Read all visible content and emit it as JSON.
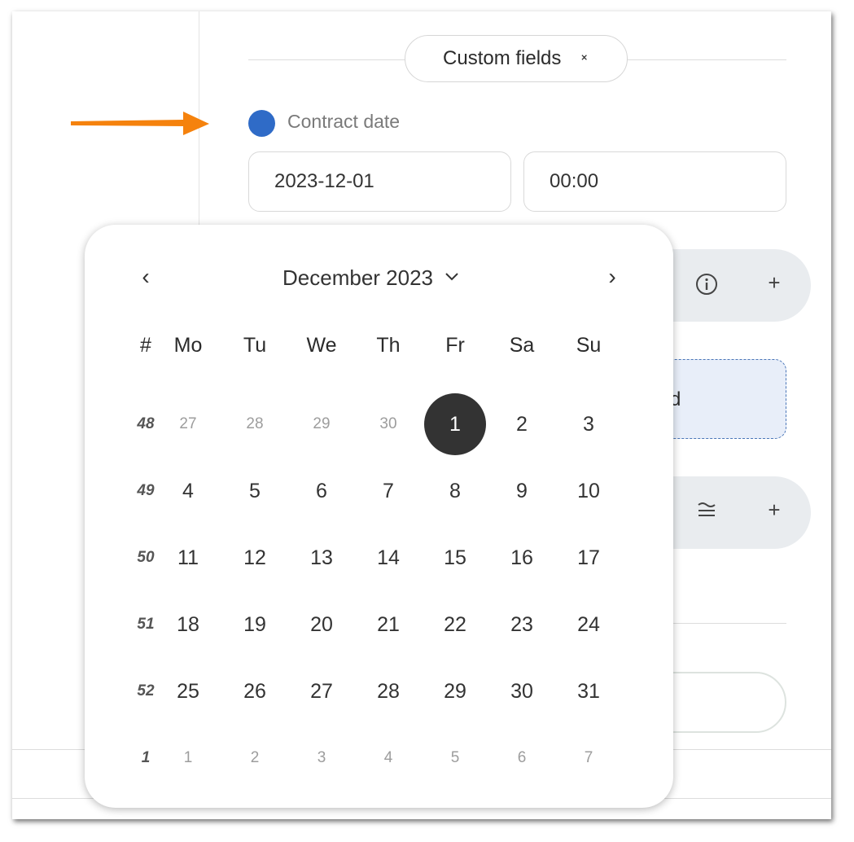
{
  "custom_fields": {
    "label": "Custom fields"
  },
  "contract_field": {
    "label": "Contract date",
    "dot_color": "#2f6bc7",
    "date_value": "2023-12-01",
    "time_value": "00:00"
  },
  "background": {
    "pill1_icons": [
      "info-icon",
      "plus-icon"
    ],
    "pill2_icons": [
      "filter-icon",
      "plus-icon"
    ],
    "dashed_text": "d"
  },
  "calendar": {
    "month_label": "December 2023",
    "week_col_header": "#",
    "weekdays": [
      "Mo",
      "Tu",
      "We",
      "Th",
      "Fr",
      "Sa",
      "Su"
    ],
    "weeks": [
      {
        "num": "48",
        "days": [
          {
            "d": "27",
            "muted": true
          },
          {
            "d": "28",
            "muted": true
          },
          {
            "d": "29",
            "muted": true
          },
          {
            "d": "30",
            "muted": true
          },
          {
            "d": "1",
            "selected": true
          },
          {
            "d": "2"
          },
          {
            "d": "3"
          }
        ]
      },
      {
        "num": "49",
        "days": [
          {
            "d": "4"
          },
          {
            "d": "5"
          },
          {
            "d": "6"
          },
          {
            "d": "7"
          },
          {
            "d": "8"
          },
          {
            "d": "9"
          },
          {
            "d": "10"
          }
        ]
      },
      {
        "num": "50",
        "days": [
          {
            "d": "11"
          },
          {
            "d": "12"
          },
          {
            "d": "13"
          },
          {
            "d": "14"
          },
          {
            "d": "15"
          },
          {
            "d": "16"
          },
          {
            "d": "17"
          }
        ]
      },
      {
        "num": "51",
        "days": [
          {
            "d": "18"
          },
          {
            "d": "19"
          },
          {
            "d": "20"
          },
          {
            "d": "21"
          },
          {
            "d": "22"
          },
          {
            "d": "23"
          },
          {
            "d": "24"
          }
        ]
      },
      {
        "num": "52",
        "days": [
          {
            "d": "25"
          },
          {
            "d": "26"
          },
          {
            "d": "27"
          },
          {
            "d": "28"
          },
          {
            "d": "29"
          },
          {
            "d": "30"
          },
          {
            "d": "31"
          }
        ]
      },
      {
        "num": "1",
        "days": [
          {
            "d": "1",
            "muted": true
          },
          {
            "d": "2",
            "muted": true
          },
          {
            "d": "3",
            "muted": true
          },
          {
            "d": "4",
            "muted": true
          },
          {
            "d": "5",
            "muted": true
          },
          {
            "d": "6",
            "muted": true
          },
          {
            "d": "7",
            "muted": true
          }
        ]
      }
    ]
  },
  "colors": {
    "accent_arrow": "#f5820d",
    "selected_day_bg": "#333333"
  }
}
